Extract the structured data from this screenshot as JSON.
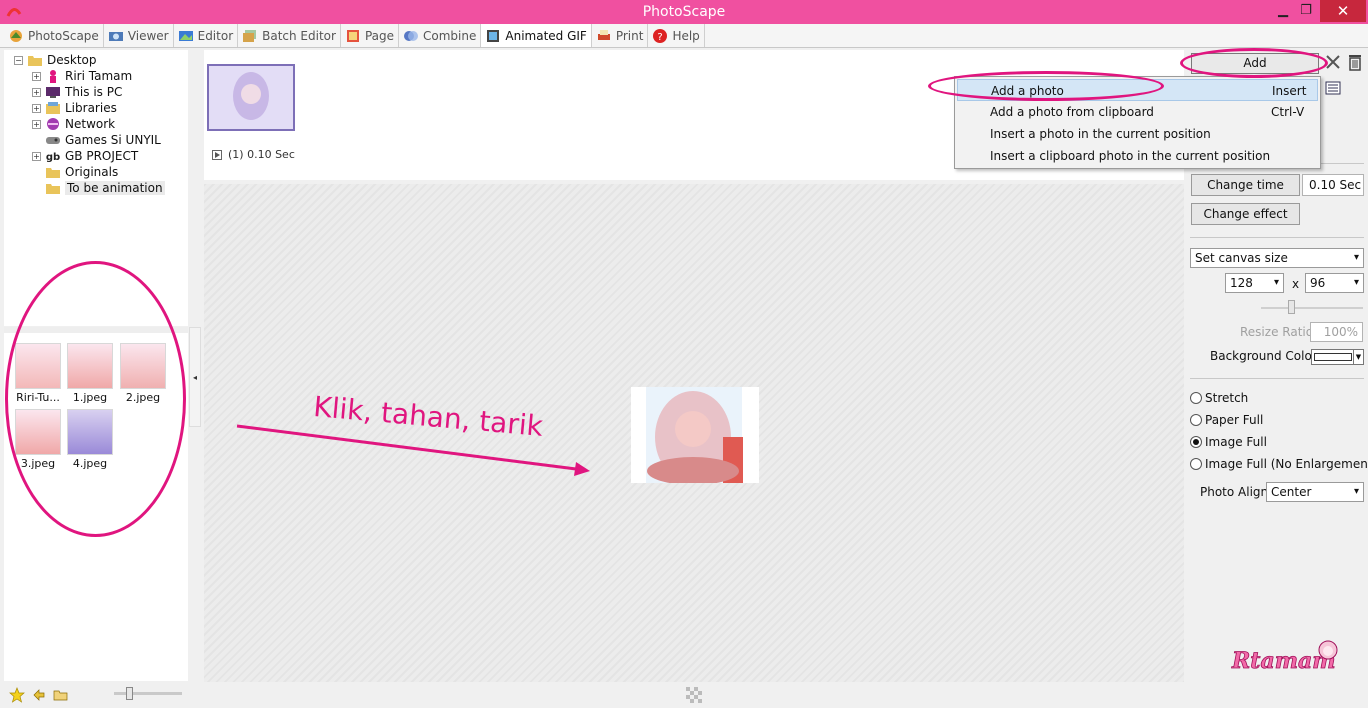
{
  "window": {
    "title": "PhotoScape"
  },
  "tabs": [
    {
      "label": "PhotoScape",
      "icon": "photoscape-icon"
    },
    {
      "label": "Viewer",
      "icon": "viewer-icon"
    },
    {
      "label": "Editor",
      "icon": "editor-icon"
    },
    {
      "label": "Batch Editor",
      "icon": "batch-editor-icon"
    },
    {
      "label": "Page",
      "icon": "page-icon"
    },
    {
      "label": "Combine",
      "icon": "combine-icon"
    },
    {
      "label": "Animated GIF",
      "icon": "animated-gif-icon"
    },
    {
      "label": "Print",
      "icon": "print-icon"
    },
    {
      "label": "Help",
      "icon": "help-icon"
    }
  ],
  "tree": [
    {
      "label": "Desktop",
      "icon": "folder-icon"
    },
    {
      "label": "Riri Tamam",
      "icon": "user-icon"
    },
    {
      "label": "This is PC",
      "icon": "computer-icon"
    },
    {
      "label": "Libraries",
      "icon": "libraries-icon"
    },
    {
      "label": "Network",
      "icon": "network-icon"
    },
    {
      "label": "Games Si UNYIL",
      "icon": "gamepad-icon"
    },
    {
      "label": "GB PROJECT",
      "icon": "project-icon"
    },
    {
      "label": "Originals",
      "icon": "folder-icon"
    },
    {
      "label": "To be animation",
      "icon": "folder-icon"
    }
  ],
  "thumbnails": [
    {
      "label": "Riri-Tu..."
    },
    {
      "label": "1.jpeg"
    },
    {
      "label": "2.jpeg"
    },
    {
      "label": "3.jpeg"
    },
    {
      "label": "4.jpeg"
    }
  ],
  "frames": {
    "info": "(1) 0.10 Sec"
  },
  "annotation": "Klik, tahan, tarik",
  "right_panel": {
    "add_label": "Add",
    "change_time_label": "Change time",
    "time_value": "0.10 Sec",
    "change_effect_label": "Change effect",
    "canvas_mode": "Set canvas size",
    "width_value": "128",
    "times_label": "x",
    "height_value": "96",
    "resize_ratio_label": "Resize Ratio",
    "resize_ratio_value": "100%",
    "background_color_label": "Background Color",
    "background_color": "#ffffff",
    "radios": [
      {
        "label": "Stretch",
        "checked": false
      },
      {
        "label": "Paper Full",
        "checked": false
      },
      {
        "label": "Image Full",
        "checked": true
      },
      {
        "label": "Image Full (No Enlargement)",
        "checked": false
      }
    ],
    "photo_align_label": "Photo Align",
    "photo_align_value": "Center"
  },
  "menu": [
    {
      "label": "Add a photo",
      "shortcut": "Insert"
    },
    {
      "label": "Add a photo from clipboard",
      "shortcut": "Ctrl-V"
    },
    {
      "label": "Insert a photo in the current position",
      "shortcut": ""
    },
    {
      "label": "Insert a clipboard photo in the current position",
      "shortcut": ""
    }
  ],
  "colors": {
    "titlebar": "#f050a0",
    "annotation": "#e0157f",
    "menu_highlight": "#d4e6f6"
  },
  "logo_text": "Rtamam"
}
